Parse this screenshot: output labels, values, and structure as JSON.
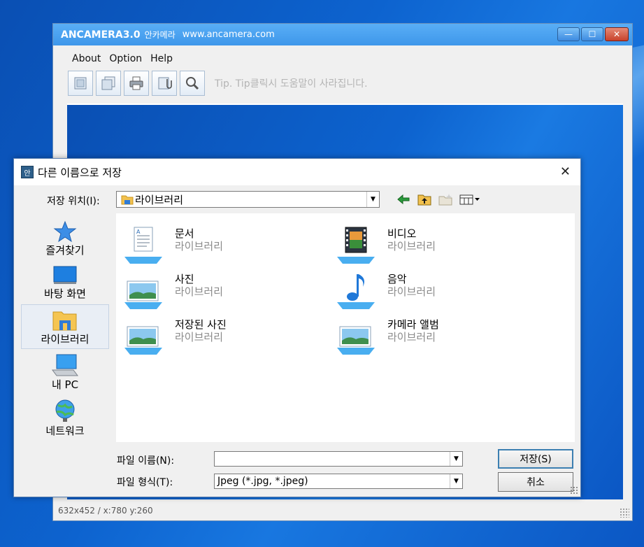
{
  "app": {
    "title": "ANCAMERA3.0",
    "subtitle": "안카메라",
    "url": "www.ancamera.com",
    "menu": [
      "About",
      "Option",
      "Help"
    ],
    "tip": "Tip. Tip클릭시 도움말이 사라집니다.",
    "status": "632x452 / x:780 y:260",
    "window_buttons": {
      "minimize": "—",
      "maximize": "☐",
      "close": "✕"
    }
  },
  "dialog": {
    "icon_text": "안",
    "title": "다른 이름으로 저장",
    "close": "✕",
    "location_label": "저장 위치(I):",
    "location_value": "라이브러리",
    "places": [
      {
        "label": "즐겨찾기",
        "icon": "favorites-star-icon"
      },
      {
        "label": "바탕 화면",
        "icon": "desktop-icon"
      },
      {
        "label": "라이브러리",
        "icon": "library-folder-icon",
        "selected": true
      },
      {
        "label": "내 PC",
        "icon": "computer-icon"
      },
      {
        "label": "네트워크",
        "icon": "network-globe-icon"
      }
    ],
    "libraries": [
      {
        "name": "문서",
        "type": "라이브러리",
        "icon": "documents-library-icon"
      },
      {
        "name": "비디오",
        "type": "라이브러리",
        "icon": "videos-library-icon"
      },
      {
        "name": "사진",
        "type": "라이브러리",
        "icon": "pictures-library-icon"
      },
      {
        "name": "음악",
        "type": "라이브러리",
        "icon": "music-library-icon"
      },
      {
        "name": "저장된 사진",
        "type": "라이브러리",
        "icon": "saved-pictures-library-icon"
      },
      {
        "name": "카메라 앨범",
        "type": "라이브러리",
        "icon": "camera-roll-library-icon"
      }
    ],
    "filename_label": "파일 이름(N):",
    "filename_value": "",
    "filetype_label": "파일 형식(T):",
    "filetype_value": "Jpeg (*.jpg, *.jpeg)",
    "save_button": "저장(S)",
    "cancel_button": "취소"
  },
  "colors": {
    "accent": "#3e97ea",
    "desktop": "#0d63cf",
    "selection": "#e9eef5"
  }
}
